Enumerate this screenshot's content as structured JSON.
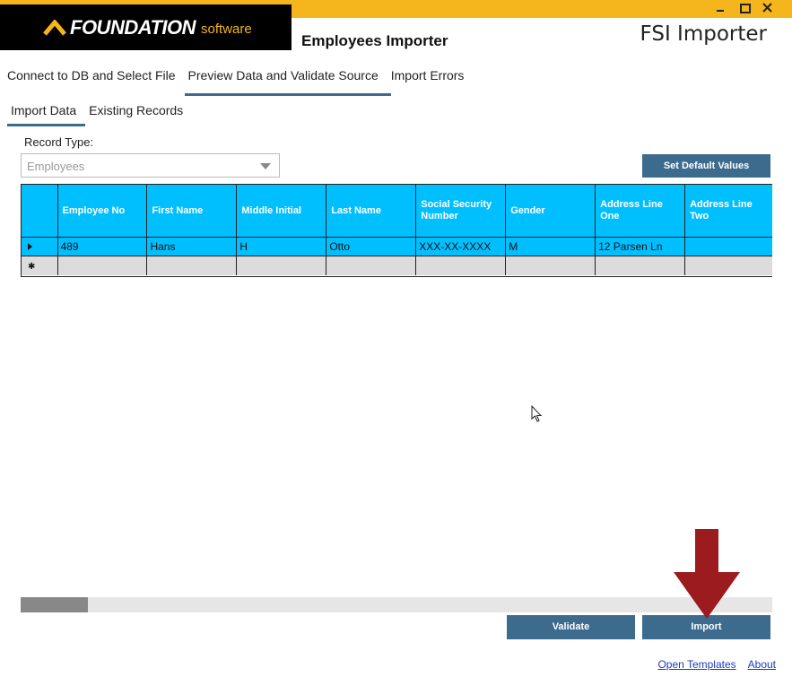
{
  "window": {
    "title": "Employees Importer",
    "app_title": "FSI Importer",
    "controls": [
      "minimize-icon",
      "maximize-icon",
      "close-icon"
    ]
  },
  "logo": {
    "word": "FOUNDATION",
    "sub": "software"
  },
  "main_tabs": [
    {
      "label": "Connect to DB and Select File",
      "active": false
    },
    {
      "label": "Preview Data and Validate Source",
      "active": true
    },
    {
      "label": "Import Errors",
      "active": false
    }
  ],
  "sub_tabs": [
    {
      "label": "Import Data",
      "active": true
    },
    {
      "label": "Existing Records",
      "active": false
    }
  ],
  "record_type": {
    "label": "Record Type:",
    "value": "Employees"
  },
  "buttons": {
    "set_default": "Set Default Values",
    "validate": "Validate",
    "import": "Import"
  },
  "grid": {
    "columns": [
      "Employee No",
      "First Name",
      "Middle Initial",
      "Last Name",
      "Social Security Number",
      "Gender",
      "Address Line One",
      "Address Line Two"
    ],
    "rows": [
      [
        "489",
        "Hans",
        "H",
        "Otto",
        "XXX-XX-XXXX",
        "M",
        "12 Parsen Ln",
        ""
      ]
    ]
  },
  "scrollbar": {
    "position_fraction": 0.0
  },
  "footer": {
    "open_templates": "Open Templates",
    "about": "About"
  },
  "colors": {
    "accent": "#3d6b8e",
    "brand": "#f5b51c",
    "grid_header": "#00bfff",
    "arrow": "#9b1b1f"
  }
}
